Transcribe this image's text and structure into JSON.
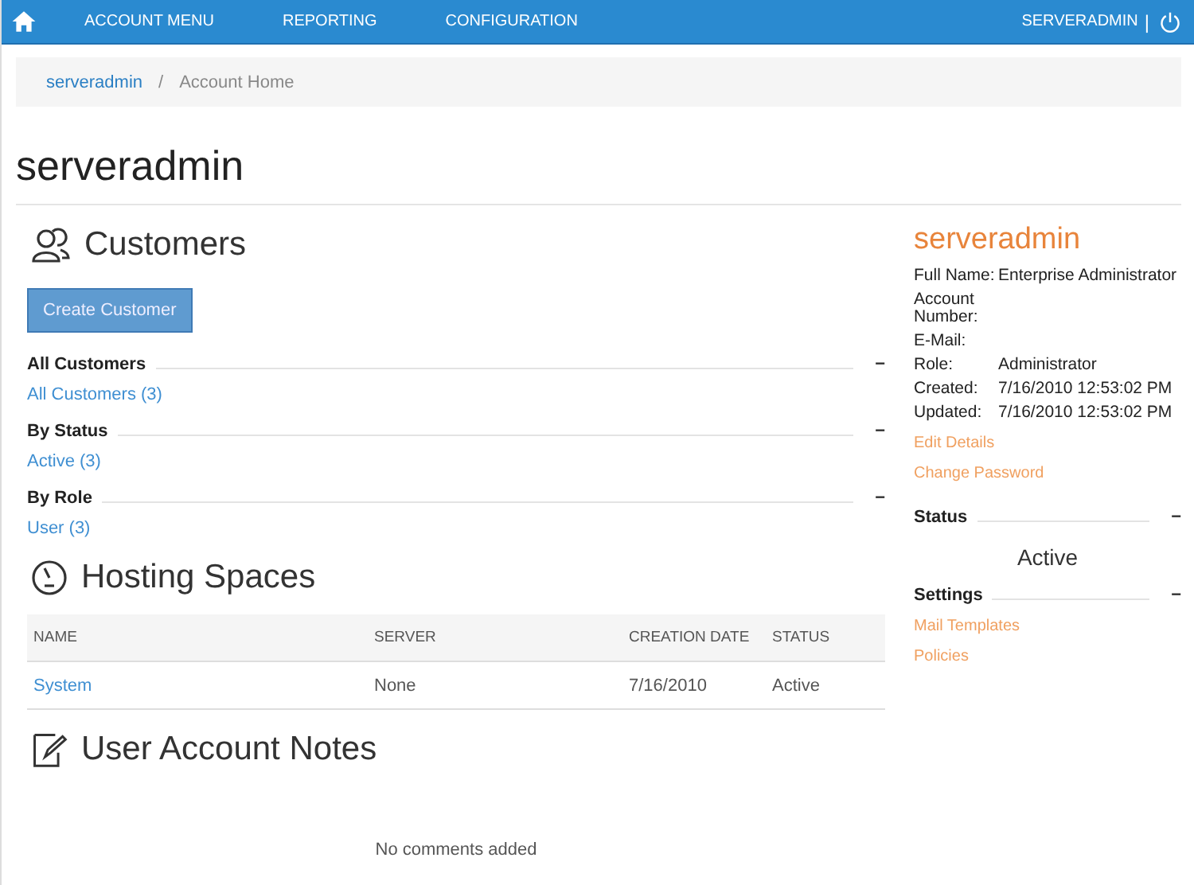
{
  "nav": {
    "items": [
      "ACCOUNT MENU",
      "REPORTING",
      "CONFIGURATION"
    ],
    "user": "SERVERADMIN",
    "separator": "|"
  },
  "breadcrumb": [
    {
      "label": "serveradmin",
      "link": true
    },
    {
      "label": "Account Home",
      "link": false
    }
  ],
  "breadcrumb_separator": "/",
  "title": "serveradmin",
  "customers": {
    "title": "Customers",
    "button": "Create Customer",
    "groups": [
      {
        "title": "All Customers",
        "toggle": "−",
        "links": [
          "All Customers (3)"
        ]
      },
      {
        "title": "By Status",
        "toggle": "−",
        "links": [
          "Active (3)"
        ]
      },
      {
        "title": "By Role",
        "toggle": "−",
        "links": [
          "User (3)"
        ]
      }
    ]
  },
  "hosting": {
    "title": "Hosting Spaces",
    "columns": [
      "NAME",
      "SERVER",
      "CREATION DATE",
      "STATUS"
    ],
    "rows": [
      [
        "System",
        "None",
        "7/16/2010",
        "Active"
      ]
    ]
  },
  "notes": {
    "title": "User Account Notes",
    "empty": "No comments added"
  },
  "profile": {
    "name": "serveradmin",
    "fields": [
      {
        "label": "Full Name:",
        "value": "Enterprise Administrator"
      },
      {
        "label": "Account Number:"
      },
      {
        "label": "E-Mail:"
      },
      {
        "label": "Role:",
        "value": "Administrator"
      },
      {
        "label": "Created:",
        "value": "7/16/2010 12:53:02 PM"
      },
      {
        "label": "Updated:",
        "value": "7/16/2010 12:53:02 PM"
      }
    ],
    "links": [
      "Edit Details",
      "Change Password"
    ],
    "status": {
      "title": "Status",
      "toggle": "−",
      "value": "Active"
    },
    "settings": {
      "title": "Settings",
      "toggle": "−",
      "links": [
        "Mail Templates",
        "Policies"
      ]
    }
  }
}
